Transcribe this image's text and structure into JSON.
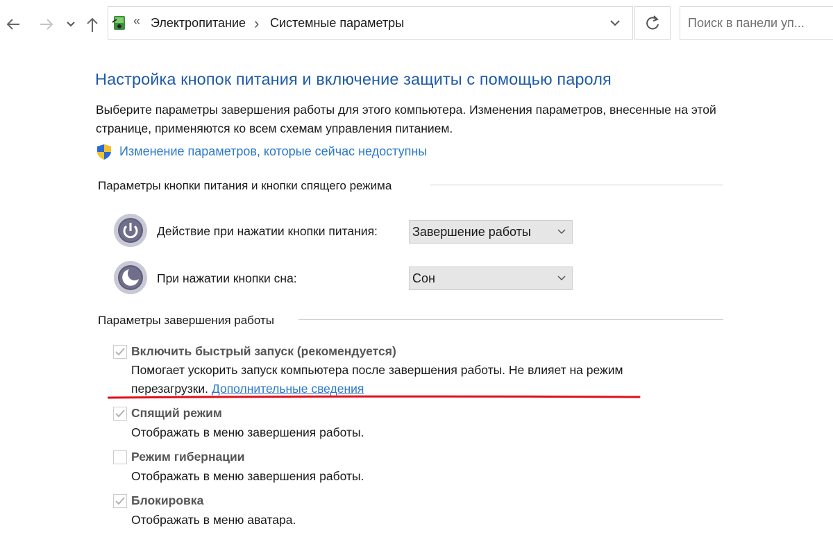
{
  "nav": {
    "back_icon": "arrow-left-icon",
    "forward_icon": "arrow-right-icon",
    "recent_icon": "chevron-down-icon",
    "up_icon": "arrow-up-icon",
    "separator": "«",
    "breadcrumbs": [
      "Электропитание",
      "Системные параметры"
    ],
    "crumb_arrow": "›",
    "search_placeholder": "Поиск в панели уп..."
  },
  "page": {
    "title": "Настройка кнопок питания и включение защиты с помощью пароля",
    "description": "Выберите параметры завершения работы для этого компьютера. Изменения параметров, внесенные на этой странице, применяются ко всем схемам управления питанием.",
    "admin_link": "Изменение параметров, которые сейчас недоступны"
  },
  "buttons_section": {
    "label": "Параметры кнопки питания и кнопки спящего режима",
    "rows": [
      {
        "label": "Действие при нажатии кнопки питания:",
        "value": "Завершение работы",
        "icon": "power-button-icon"
      },
      {
        "label": "При нажатии кнопки сна:",
        "value": "Сон",
        "icon": "sleep-button-icon"
      }
    ]
  },
  "shutdown_section": {
    "label": "Параметры завершения работы",
    "options": [
      {
        "title": "Включить быстрый запуск (рекомендуется)",
        "desc_line1": "Помогает ускорить запуск компьютера после завершения работы. Не влияет на режим",
        "desc_line2": "перезагрузки.",
        "link": "Дополнительные сведения",
        "checked": true
      },
      {
        "title": "Спящий режим",
        "desc": "Отображать в меню завершения работы.",
        "checked": true
      },
      {
        "title": "Режим гибернации",
        "desc": "Отображать в меню завершения работы.",
        "checked": false
      },
      {
        "title": "Блокировка",
        "desc": "Отображать в меню аватара.",
        "checked": true
      }
    ]
  },
  "colors": {
    "title": "#1e5aa8",
    "link": "#2b78c9",
    "annotation_underline": "#e0101a"
  }
}
